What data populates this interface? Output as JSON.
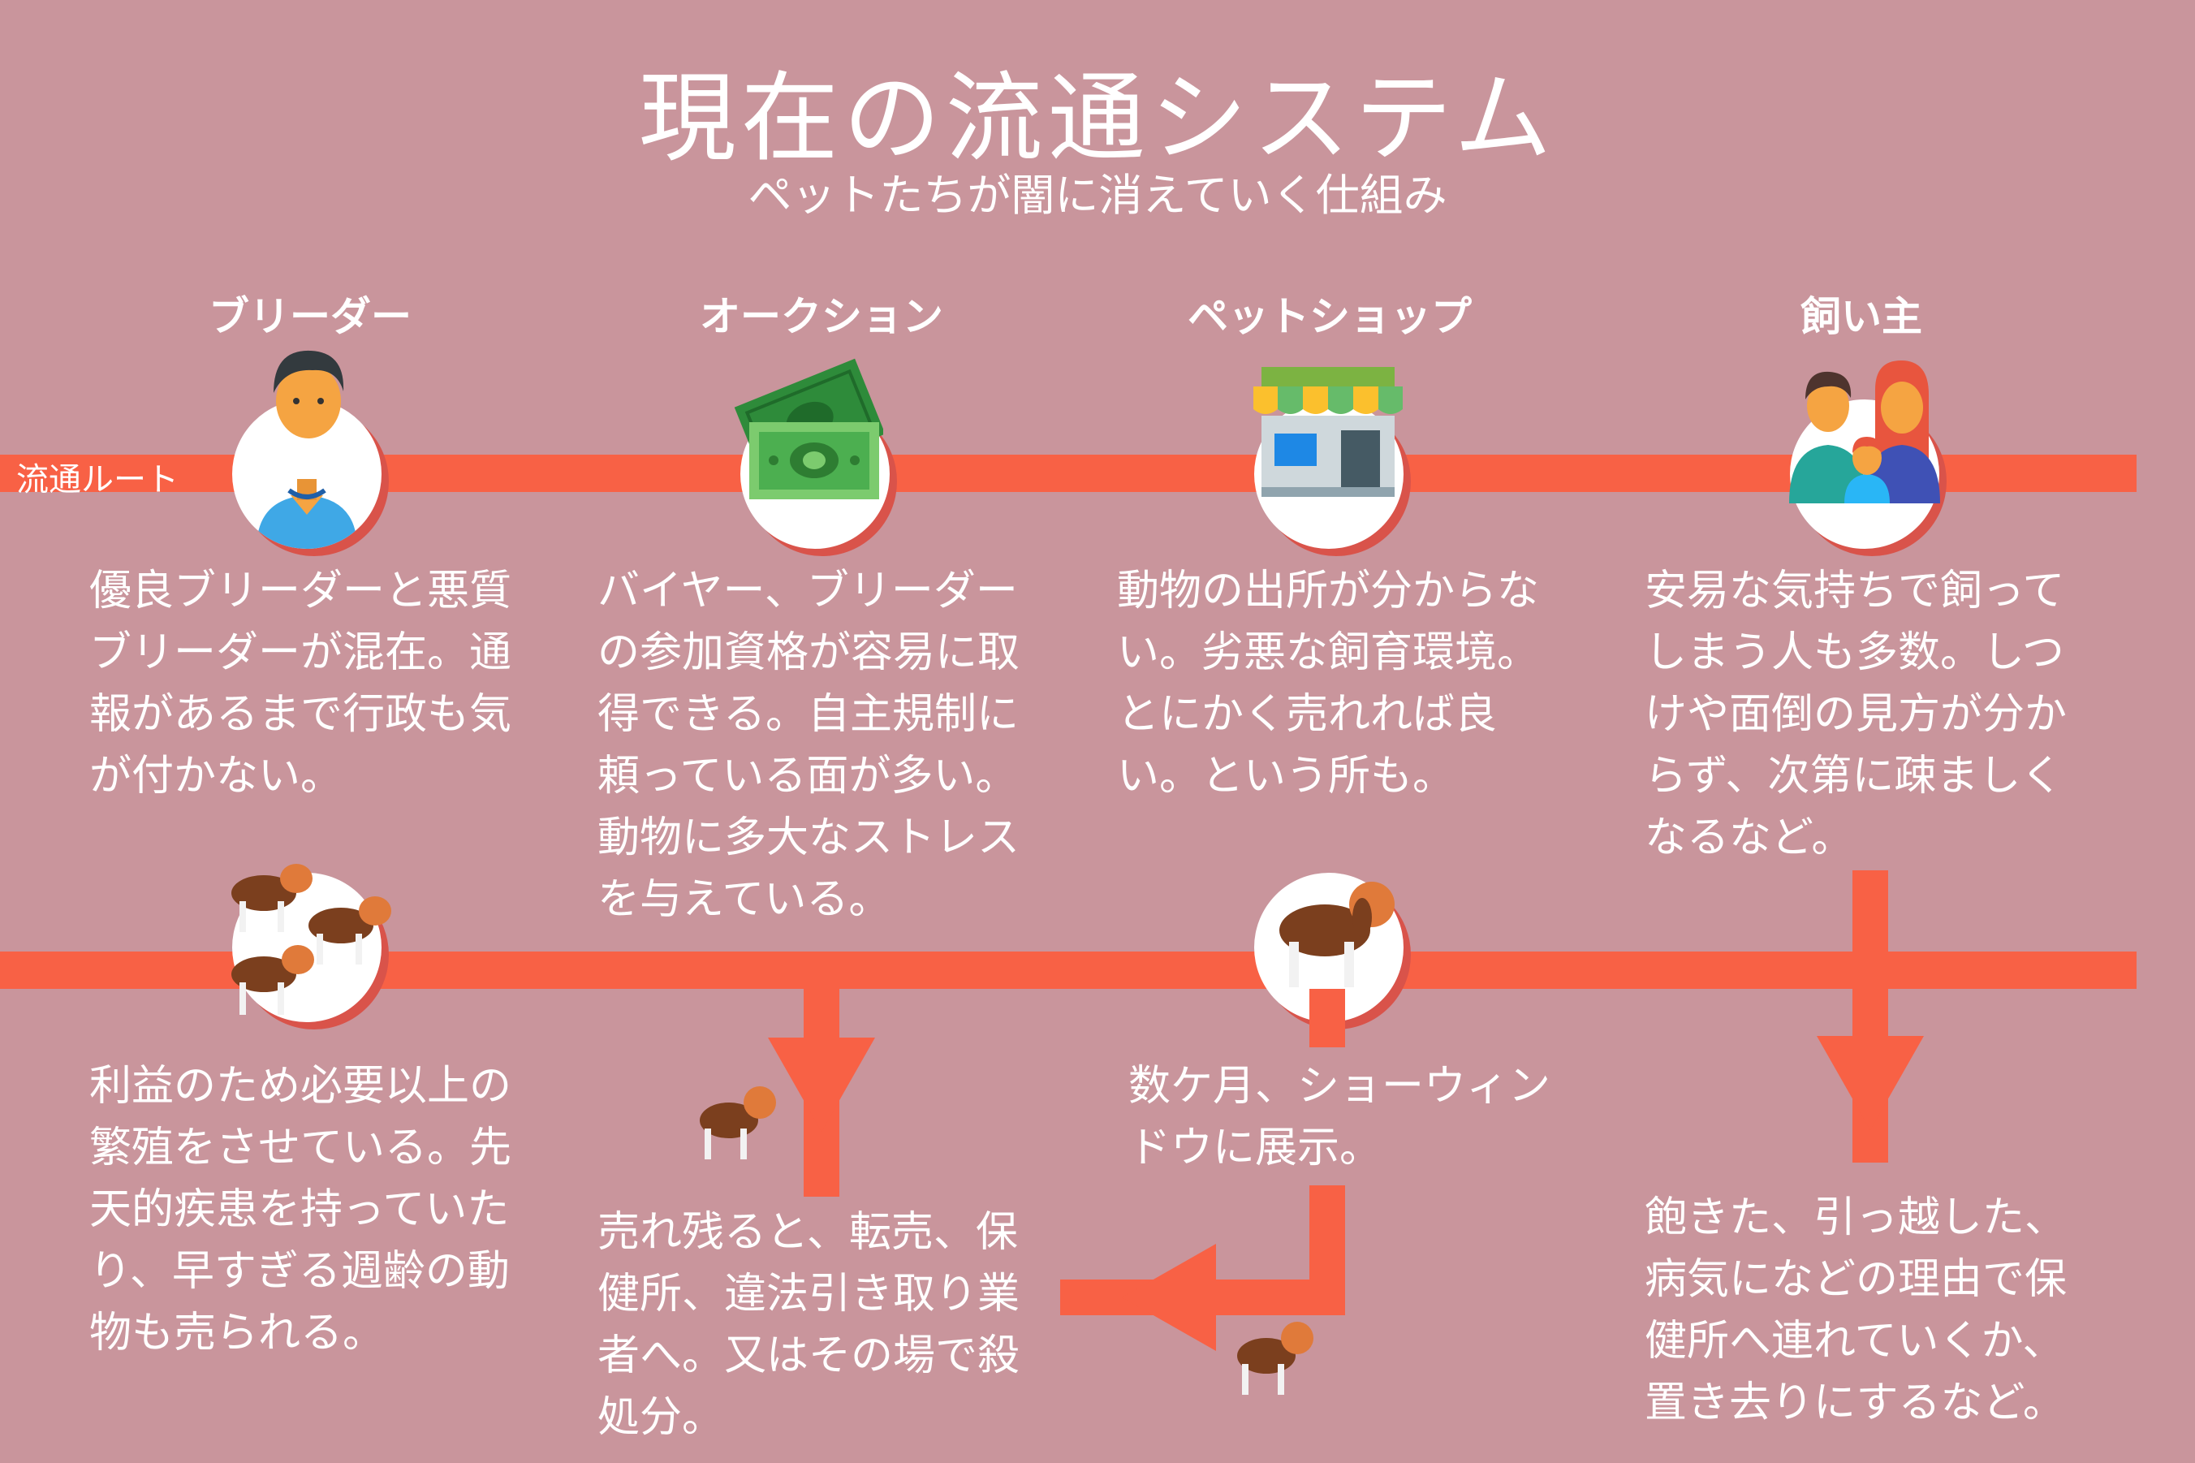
{
  "header": {
    "title": "現在の流通システム",
    "subtitle": "ペットたちが闇に消えていく仕組み"
  },
  "route_label": "流通ルート",
  "columns": [
    {
      "title": "ブリーダー",
      "icon": "breeder-person-icon",
      "desc_top": "優良ブリーダーと悪質ブリーダーが混在。通報があるまで行政も気が付かない。",
      "desc_bottom": "利益のため必要以上の繁殖をさせている。先天的疾患を持っていたり、早すぎる週齢の動物も売られる。"
    },
    {
      "title": "オークション",
      "icon": "money-icon",
      "desc_top": "バイヤー、ブリーダーの参加資格が容易に取得できる。自主規制に頼っている面が多い。動物に多大なストレスを与えている。",
      "desc_bottom": "売れ残ると、転売、保健所、違法引き取り業者へ。又はその場で殺処分。"
    },
    {
      "title": "ペットショップ",
      "icon": "pet-shop-icon",
      "desc_top": "動物の出所が分からない。劣悪な飼育環境。とにかく売れれば良い。という所も。",
      "desc_bottom": "数ケ月、ショーウィンドウに展示。"
    },
    {
      "title": "飼い主",
      "icon": "family-icon",
      "desc_top": "安易な気持ちで飼ってしまう人も多数。しつけや面倒の見方が分からず、次第に疎ましくなるなど。",
      "desc_bottom": "飽きた、引っ越した、病気になどの理由で保健所へ連れていくか、置き去りにするなど。"
    }
  ],
  "colors": {
    "background": "#c9959c",
    "route": "#f86145",
    "circle_shadow": "#d9534a",
    "text": "#ffffff"
  }
}
